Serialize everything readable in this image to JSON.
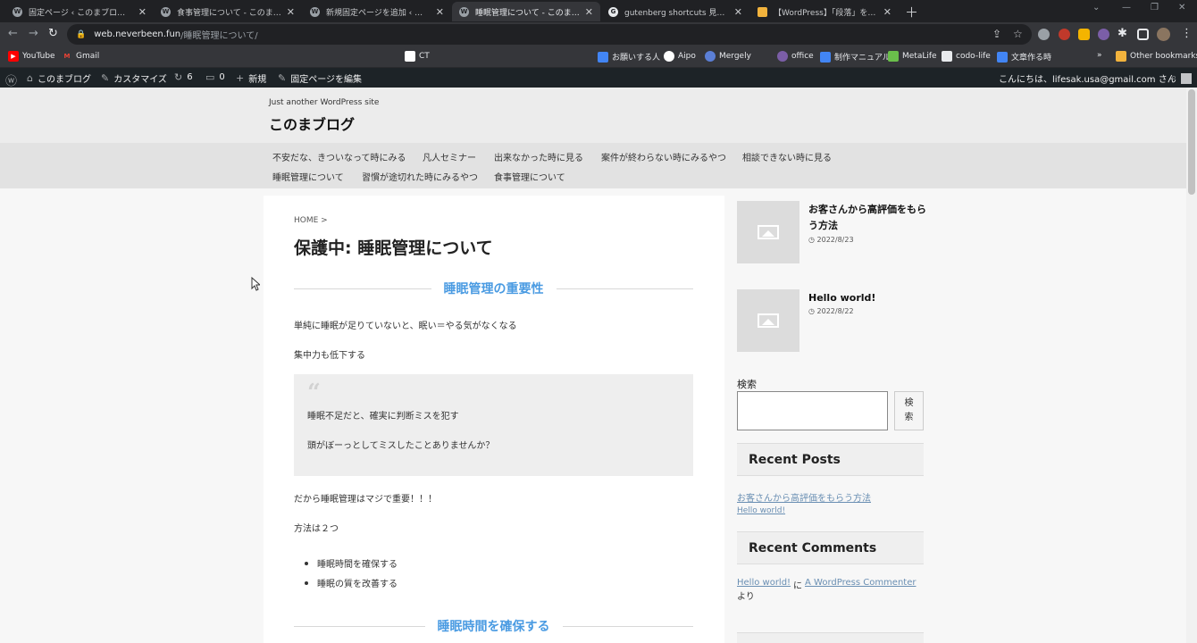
{
  "browser": {
    "tabs": [
      {
        "title": "固定ページ ‹ このまブログ — WordPr",
        "icon": "wordpress-icon"
      },
      {
        "title": "食事管理について - このまブログ",
        "icon": "wordpress-icon"
      },
      {
        "title": "新規固定ページを追加 ‹ このまブログ",
        "icon": "wordpress-icon"
      },
      {
        "title": "睡眠管理について - このまブログ",
        "icon": "wordpress-icon"
      },
      {
        "title": "gutenberg shortcuts 見出し - Goo",
        "icon": "google-icon"
      },
      {
        "title": "【WordPress】「段落」を「見出し」に",
        "icon": "bookmark-icon"
      }
    ],
    "url_domain": "web.neverbeen.fun",
    "url_path": "/睡眠管理について/",
    "bookmarks": [
      {
        "label": "YouTube",
        "color": "#ff0000"
      },
      {
        "label": "Gmail",
        "color": "#ea4335"
      },
      {
        "label": "CT",
        "color": "#ffffff"
      },
      {
        "label": "お願いする人",
        "color": "#4285f4"
      },
      {
        "label": "Aipo",
        "color": "#ffffff"
      },
      {
        "label": "Mergely",
        "color": "#5b7fd6"
      },
      {
        "label": "office",
        "color": "#7b5ea7"
      },
      {
        "label": "制作マニュアル",
        "color": "#4285f4"
      },
      {
        "label": "MetaLife",
        "color": "#6abf4b"
      },
      {
        "label": "codo-life",
        "color": "#4285f4"
      },
      {
        "label": "文章作る時",
        "color": "#4285f4"
      },
      {
        "label": "Other bookmarks",
        "color": "#f2b33d"
      }
    ]
  },
  "adminbar": {
    "site": "このまブログ",
    "customize": "カスタマイズ",
    "updates": "6",
    "comments": "0",
    "new": "新規",
    "edit": "固定ページを編集",
    "greeting": "こんにちは、lifesak.usa@gmail.com さん"
  },
  "site": {
    "tagline": "Just another WordPress site",
    "title": "このまブログ",
    "nav": [
      "不安だな、きついなって時にみる",
      "凡人セミナー",
      "出来なかった時に見る",
      "案件が終わらない時にみるやつ",
      "相談できない時に見る",
      "睡眠管理について",
      "習慣が途切れた時にみるやつ",
      "食事管理について"
    ]
  },
  "article": {
    "breadcrumb": "HOME >",
    "title": "保護中: 睡眠管理について",
    "h2_1": "睡眠管理の重要性",
    "p1": "単純に睡眠が足りていないと、眠い＝やる気がなくなる",
    "p2": "集中力も低下する",
    "quote_line1": "睡眠不足だと、確実に判断ミスを犯す",
    "quote_line2": "頭がぼーっとしてミスしたことありませんか？",
    "p3": "だから睡眠管理はマジで重要！！！",
    "p4": "方法は２つ",
    "list": [
      "睡眠時間を確保する",
      "睡眠の質を改善する"
    ],
    "h2_2": "睡眠時間を確保する"
  },
  "sidebar": {
    "posts": [
      {
        "title": "お客さんから高評価をもらう方法",
        "date": "2022/8/23"
      },
      {
        "title": "Hello world!",
        "date": "2022/8/22"
      }
    ],
    "search_label": "検索",
    "search_button": "検索",
    "recent_posts_title": "Recent Posts",
    "recent_posts": [
      "お客さんから高評価をもらう方法",
      "Hello world!"
    ],
    "recent_comments_title": "Recent Comments",
    "comment_post": "Hello world!",
    "comment_on": "に",
    "comment_author": "A WordPress Commenter",
    "comment_suffix": "より"
  },
  "colors": {
    "accent": "#4a9be2",
    "link": "#6a8fb3",
    "adminbar": "#1d2327"
  }
}
